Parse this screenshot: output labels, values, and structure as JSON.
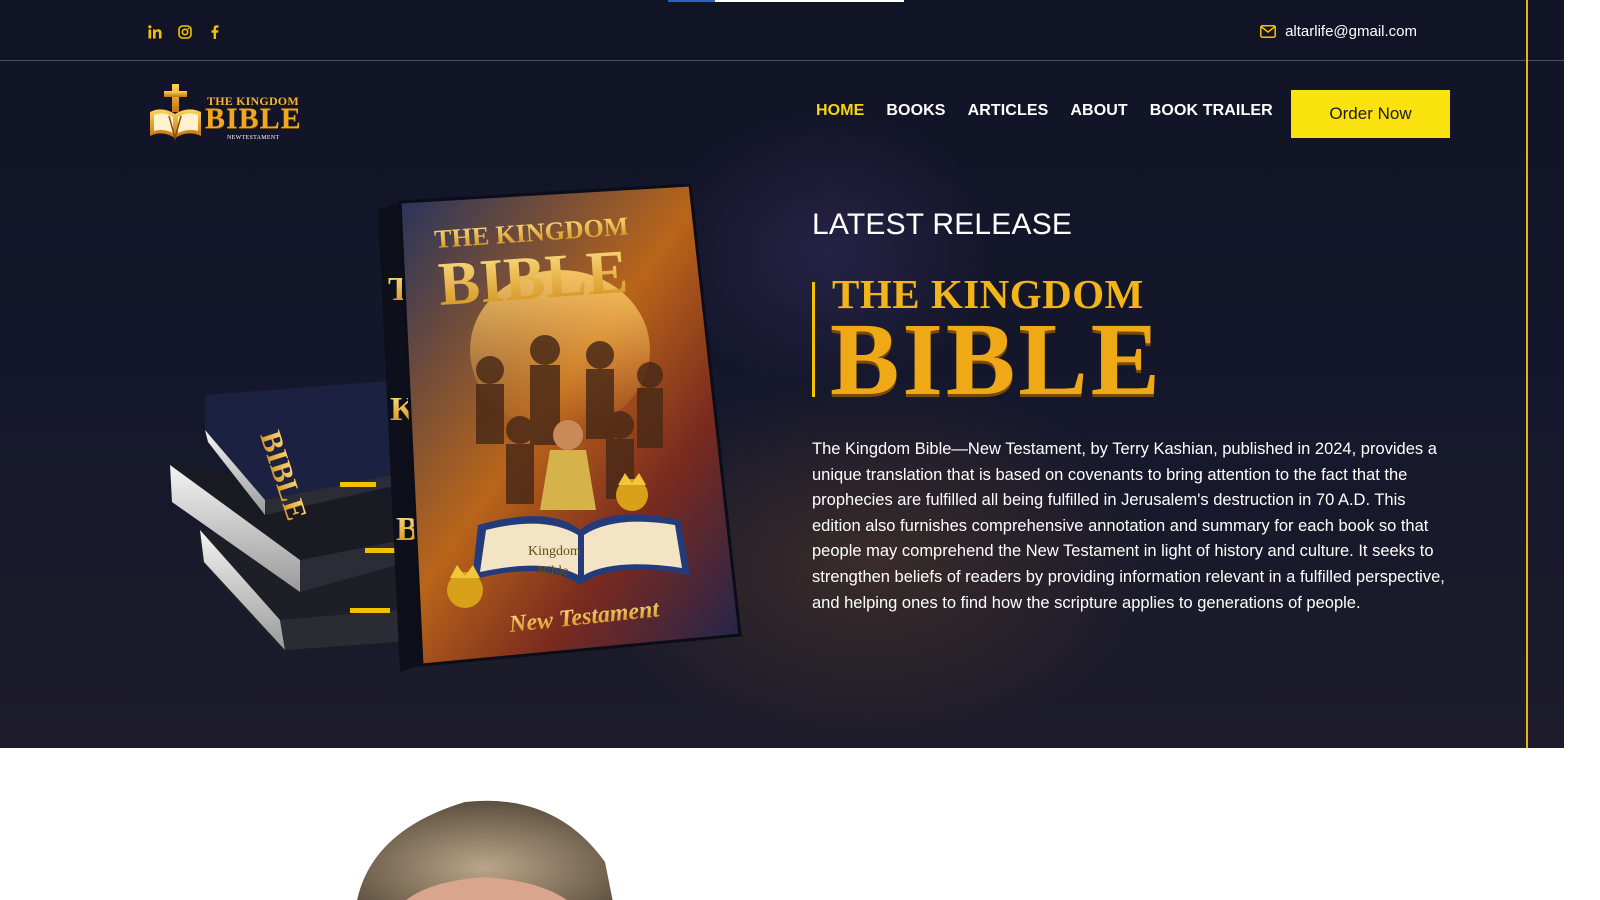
{
  "topbar": {
    "social": [
      "linkedin-icon",
      "instagram-icon",
      "facebook-icon"
    ],
    "email": "altarlife@gmail.com",
    "progress": 0.2
  },
  "logo": {
    "line1": "THE KINGDOM",
    "line2": "BIBLE",
    "line3": "NEWTESTAMENT"
  },
  "nav": {
    "items": [
      "HOME",
      "BOOKS",
      "ARTICLES",
      "ABOUT",
      "BOOK TRAILER"
    ],
    "active": "HOME",
    "cta": "Order Now"
  },
  "hero": {
    "eyebrow": "LATEST RELEASE",
    "title_line1": "THE KINGDOM",
    "title_line2": "BIBLE",
    "description": "The Kingdom Bible—New Testament, by Terry Kashian, published in 2024, provides a unique translation that is based on covenants to bring attention to the fact that the prophecies are fulfilled all being fulfilled in Jerusalem's destruction in 70 A.D. This edition also furnishes comprehensive annotation and summary for each book so that people may comprehend the New Testament in light of history and culture. It seeks to strengthen beliefs of readers by providing information relevant in a fulfilled perspective, and helping ones to find how the scripture applies to generations of people.",
    "book_cover": {
      "top": "THE KINGDOM",
      "big": "BIBLE",
      "inner1": "The",
      "inner2": "Kingdom",
      "inner3": "Bible",
      "bottom": "New Testament",
      "spine": "TKB"
    }
  },
  "colors": {
    "accent_yellow": "#f9e20d",
    "gold": "#f0a916",
    "hero_bg": "#131528",
    "nav_active": "#f7d417"
  }
}
